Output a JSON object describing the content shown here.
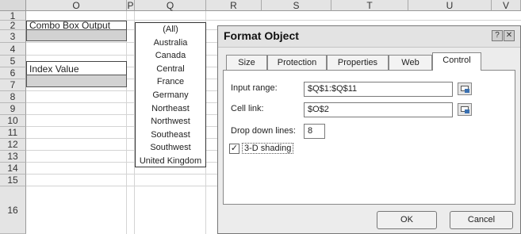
{
  "sheet": {
    "columns": [
      "O",
      "P",
      "Q",
      "R",
      "S",
      "T",
      "U",
      "V"
    ],
    "rows": [
      "1",
      "2",
      "3",
      "4",
      "5",
      "6",
      "7",
      "8",
      "9",
      "10",
      "11",
      "12",
      "13",
      "14",
      "15",
      "16"
    ],
    "combo_label": "Combo Box Output",
    "index_label": "Index Value",
    "list_items": [
      "(All)",
      "Australia",
      "Canada",
      "Central",
      "France",
      "Germany",
      "Northeast",
      "Northwest",
      "Southeast",
      "Southwest",
      "United Kingdom"
    ]
  },
  "dialog": {
    "title": "Format Object",
    "help_glyph": "?",
    "close_glyph": "✕",
    "tabs": [
      "Size",
      "Protection",
      "Properties",
      "Web",
      "Control"
    ],
    "active_tab": "Control",
    "input_range_label": "Input range:",
    "input_range_value": "$Q$1:$Q$11",
    "cell_link_label": "Cell link:",
    "cell_link_value": "$O$2",
    "drop_down_label": "Drop down lines:",
    "drop_down_value": "8",
    "shading_label": "3-D shading",
    "shading_checked": true,
    "check_glyph": "✓",
    "ok_label": "OK",
    "cancel_label": "Cancel"
  }
}
